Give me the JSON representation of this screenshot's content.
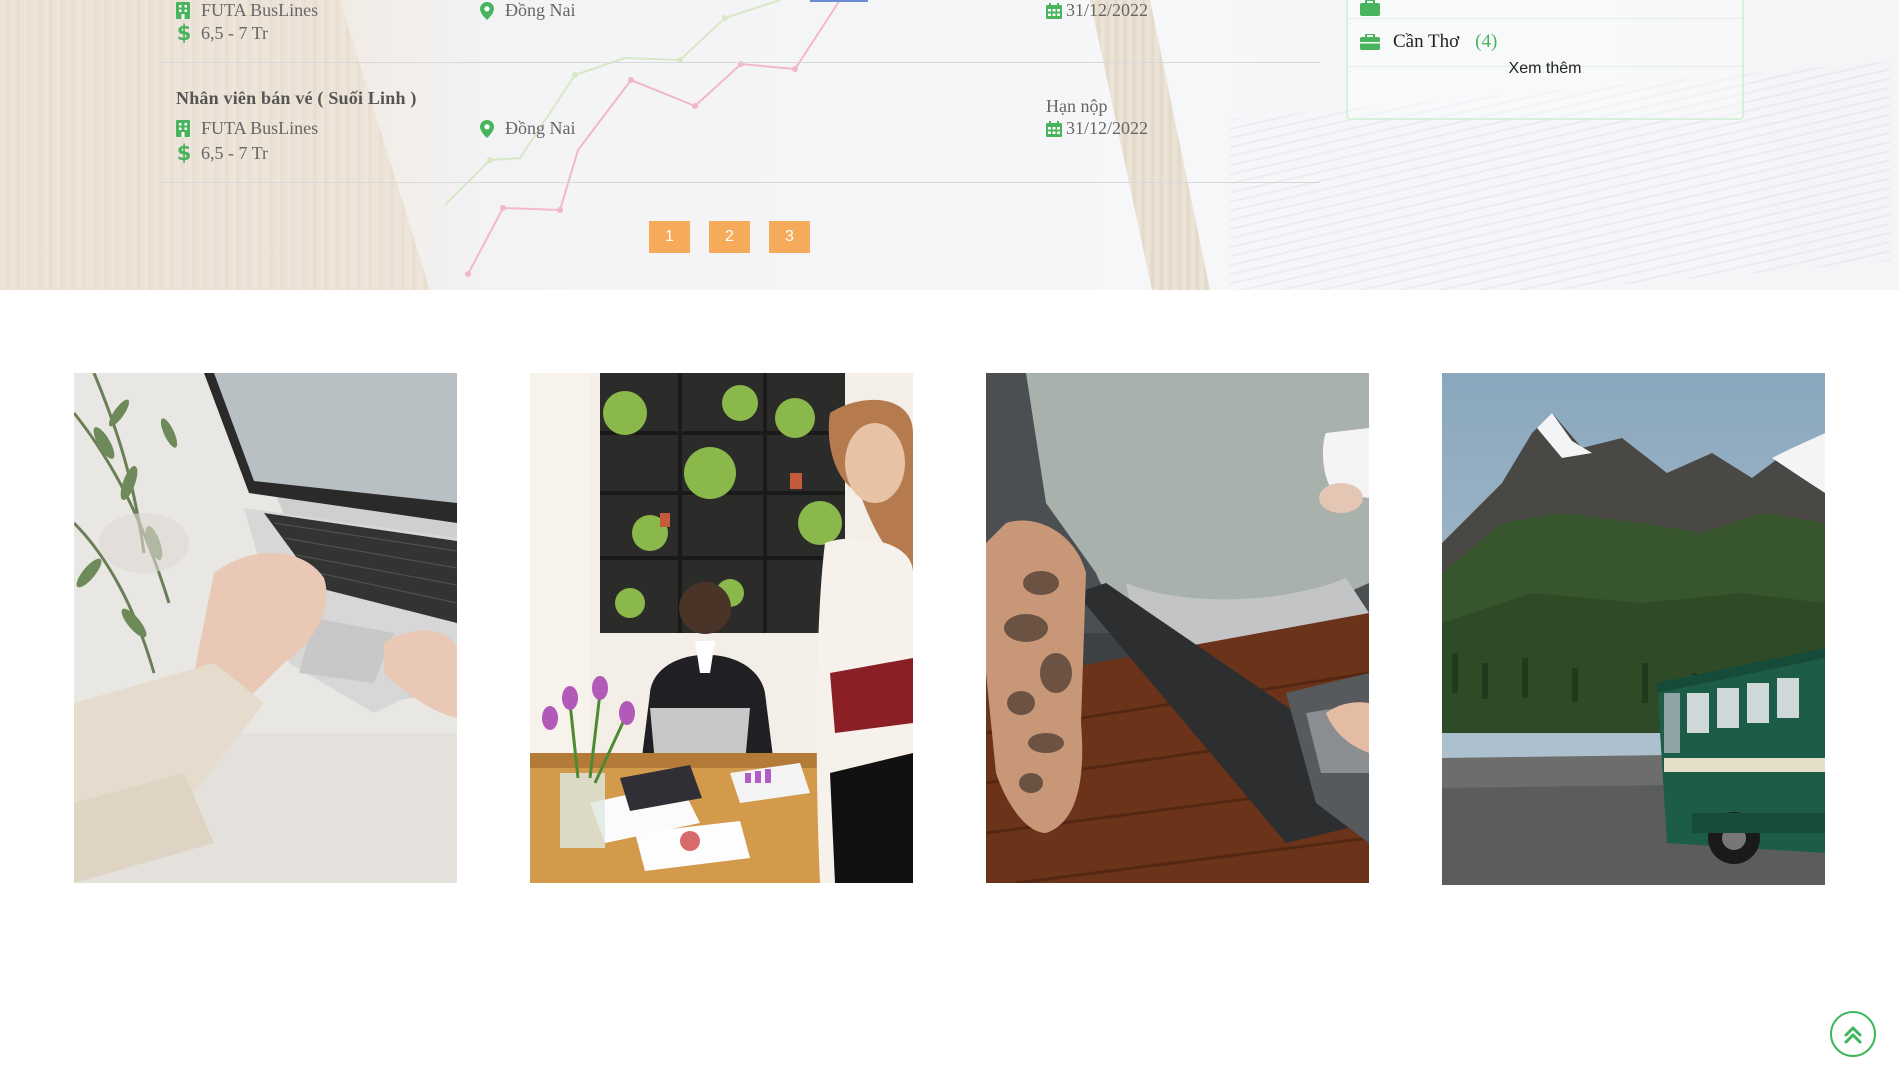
{
  "jobs": [
    {
      "title": "",
      "company": "FUTA BusLines",
      "salary": "6,5 - 7 Tr",
      "location": "Đồng Nai",
      "deadline_label": "",
      "deadline": "31/12/2022"
    },
    {
      "title": "Nhân viên bán vé ( Suối Linh )",
      "company": "FUTA BusLines",
      "salary": "6,5 - 7 Tr",
      "location": "Đồng Nai",
      "deadline_label": "Hạn nộp",
      "deadline": "31/12/2022"
    }
  ],
  "pagination": {
    "pages": [
      "1",
      "2",
      "3"
    ]
  },
  "sidebar": {
    "cities": [
      {
        "name": "Cần Thơ",
        "count": "(4)"
      }
    ],
    "more_label": "Xem thêm"
  },
  "gallery": {
    "images": [
      {
        "icon": "photo-laptop-hands"
      },
      {
        "icon": "photo-office-meeting"
      },
      {
        "icon": "photo-tattoo-laptop"
      },
      {
        "icon": "photo-bus-mountain"
      }
    ]
  },
  "colors": {
    "accent_green": "#48b45e",
    "pager_orange": "#f5ab5a",
    "text_gray": "#555555"
  },
  "icons": {
    "company": "building-icon",
    "salary": "dollar-icon",
    "location": "map-pin-icon",
    "deadline": "calendar-icon",
    "city": "briefcase-icon",
    "back_to_top": "double-chevron-up-icon"
  }
}
